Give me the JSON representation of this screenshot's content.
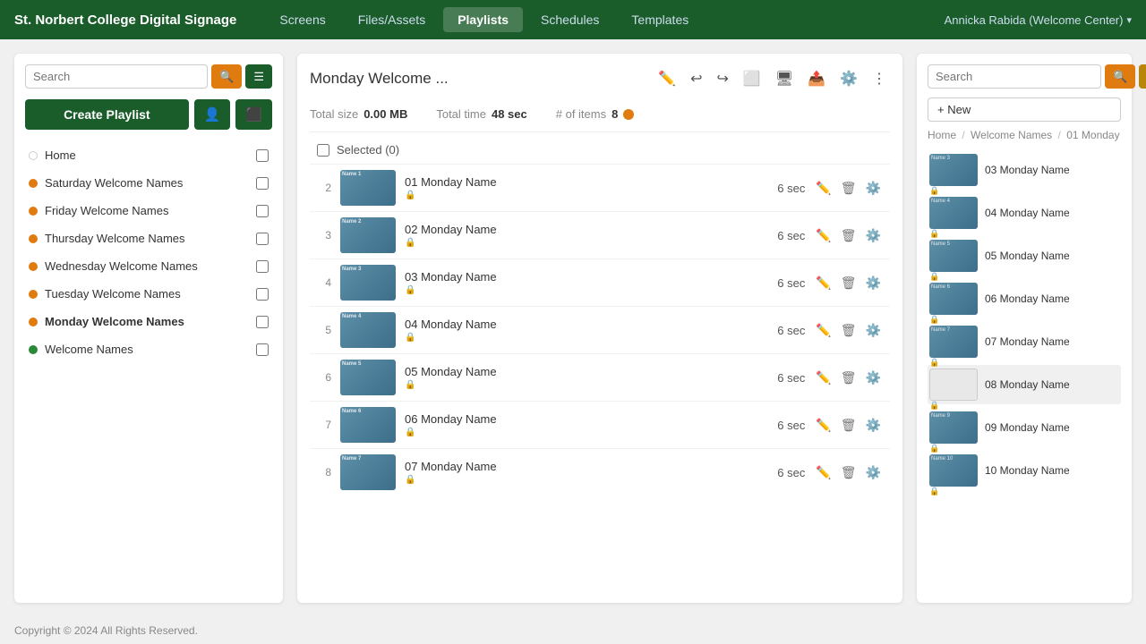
{
  "brand": "St. Norbert College Digital Signage",
  "nav": {
    "links": [
      "Screens",
      "Files/Assets",
      "Playlists",
      "Schedules",
      "Templates"
    ],
    "active": "Playlists",
    "user": "Annicka Rabida (Welcome Center)"
  },
  "left": {
    "search_placeholder": "Search",
    "create_label": "Create Playlist",
    "playlists": [
      {
        "name": "Home",
        "dot": "none",
        "active": false
      },
      {
        "name": "Saturday Welcome Names",
        "dot": "orange",
        "active": false
      },
      {
        "name": "Friday Welcome Names",
        "dot": "orange",
        "active": false
      },
      {
        "name": "Thursday Welcome Names",
        "dot": "orange",
        "active": false
      },
      {
        "name": "Wednesday Welcome Names",
        "dot": "orange",
        "active": false
      },
      {
        "name": "Tuesday Welcome Names",
        "dot": "orange",
        "active": false
      },
      {
        "name": "Monday Welcome Names",
        "dot": "orange",
        "active": true
      },
      {
        "name": "Welcome Names",
        "dot": "green",
        "active": false
      }
    ]
  },
  "center": {
    "title": "Monday Welcome ...",
    "stats": {
      "total_size_label": "Total size",
      "total_size_value": "0.00 MB",
      "total_time_label": "Total time",
      "total_time_value": "48 sec",
      "items_label": "# of items",
      "items_value": "8"
    },
    "selected_label": "Selected (0)",
    "items": [
      {
        "num": 2,
        "name": "01 Monday Name",
        "sec": "6 sec"
      },
      {
        "num": 3,
        "name": "02 Monday Name",
        "sec": "6 sec"
      },
      {
        "num": 4,
        "name": "03 Monday Name",
        "sec": "6 sec"
      },
      {
        "num": 5,
        "name": "04 Monday Name",
        "sec": "6 sec"
      },
      {
        "num": 6,
        "name": "05 Monday Name",
        "sec": "6 sec"
      },
      {
        "num": 7,
        "name": "06 Monday Name",
        "sec": "6 sec"
      },
      {
        "num": 8,
        "name": "07 Monday Name",
        "sec": "6 sec"
      }
    ]
  },
  "right": {
    "search_placeholder": "Search",
    "new_label": "+ New",
    "breadcrumb": [
      "Home",
      "Welcome Names",
      "01 Monday"
    ],
    "items": [
      {
        "name": "03 Monday Name",
        "white": false
      },
      {
        "name": "04 Monday Name",
        "white": false
      },
      {
        "name": "05 Monday Name",
        "white": false
      },
      {
        "name": "06 Monday Name",
        "white": false
      },
      {
        "name": "07 Monday Name",
        "white": false
      },
      {
        "name": "08 Monday Name",
        "white": true
      },
      {
        "name": "09 Monday Name",
        "white": false
      },
      {
        "name": "10 Monday Name",
        "white": false
      }
    ]
  },
  "footer": {
    "text": "Copyright © 2024 All Rights Reserved."
  }
}
